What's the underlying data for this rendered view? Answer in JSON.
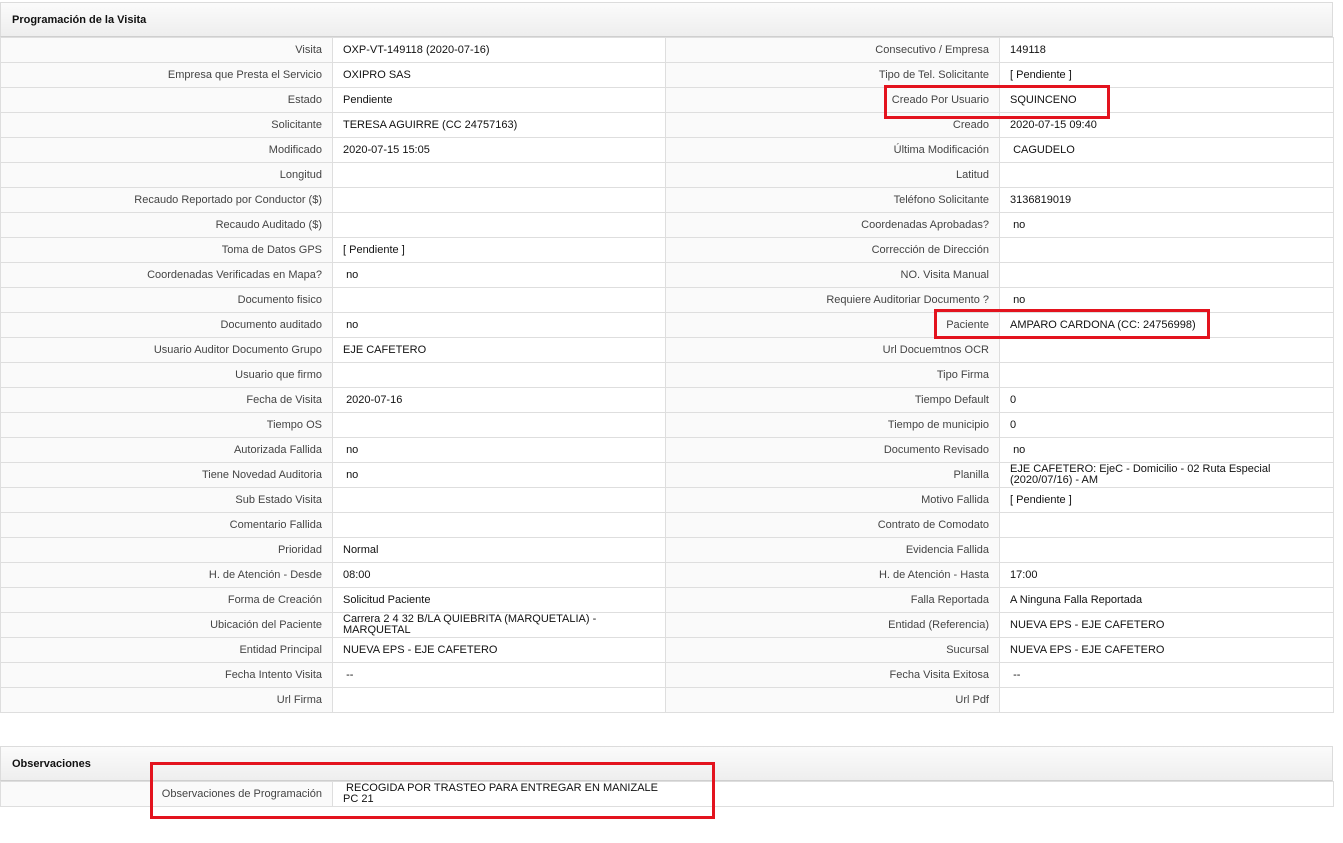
{
  "programacion": {
    "title": "Programación de la Visita",
    "rows": [
      [
        "Visita",
        "OXP-VT-149118 (2020-07-16)",
        "Consecutivo / Empresa",
        "149118"
      ],
      [
        "Empresa que Presta el Servicio",
        "OXIPRO SAS",
        "Tipo de Tel. Solicitante",
        "[ Pendiente ]"
      ],
      [
        "Estado",
        "Pendiente",
        "Creado Por Usuario",
        "SQUINCENO"
      ],
      [
        "Solicitante",
        "TERESA AGUIRRE (CC 24757163)",
        "Creado",
        "2020-07-15 09:40"
      ],
      [
        "Modificado",
        "2020-07-15 15:05",
        "Última Modificación",
        " CAGUDELO"
      ],
      [
        "Longitud",
        "",
        "Latitud",
        ""
      ],
      [
        "Recaudo Reportado por Conductor ($)",
        "",
        "Teléfono Solicitante",
        "3136819019"
      ],
      [
        "Recaudo Auditado ($)",
        "",
        "Coordenadas Aprobadas?",
        " no"
      ],
      [
        "Toma de Datos GPS",
        "[ Pendiente ]",
        "Corrección de Dirección",
        ""
      ],
      [
        "Coordenadas Verificadas en Mapa?",
        " no",
        "NO. Visita Manual",
        ""
      ],
      [
        "Documento fisico",
        "",
        "Requiere Auditoriar Documento ?",
        " no"
      ],
      [
        "Documento auditado",
        " no",
        "Paciente",
        "AMPARO CARDONA (CC: 24756998)"
      ],
      [
        "Usuario Auditor Documento Grupo",
        "EJE CAFETERO",
        "Url Docuemtnos OCR",
        ""
      ],
      [
        "Usuario que firmo",
        "",
        "Tipo Firma",
        ""
      ],
      [
        "Fecha de Visita",
        " 2020-07-16",
        "Tiempo Default",
        "0"
      ],
      [
        "Tiempo OS",
        "",
        "Tiempo de municipio",
        "0"
      ],
      [
        "Autorizada Fallida",
        " no",
        "Documento Revisado",
        " no"
      ],
      [
        "Tiene Novedad Auditoria",
        " no",
        "Planilla",
        "EJE CAFETERO: EjeC - Domicilio - 02 Ruta Especial (2020/07/16) - AM"
      ],
      [
        "Sub Estado Visita",
        "",
        "Motivo Fallida",
        "[ Pendiente ]"
      ],
      [
        "Comentario Fallida",
        "",
        "Contrato de Comodato",
        ""
      ],
      [
        "Prioridad",
        "Normal",
        "Evidencia Fallida",
        ""
      ],
      [
        "H. de Atención - Desde",
        "08:00",
        "H. de Atención - Hasta",
        "17:00"
      ],
      [
        "Forma de Creación",
        "Solicitud Paciente",
        "Falla Reportada",
        "A Ninguna Falla Reportada"
      ],
      [
        "Ubicación del Paciente",
        "Carrera 2 4 32 B/LA QUIEBRITA (MARQUETALIA) - MARQUETAL",
        "Entidad (Referencia)",
        "NUEVA EPS - EJE CAFETERO"
      ],
      [
        "Entidad Principal",
        "NUEVA EPS - EJE CAFETERO",
        "Sucursal",
        "NUEVA EPS - EJE CAFETERO"
      ],
      [
        "Fecha Intento Visita",
        " --",
        "Fecha Visita Exitosa",
        " --"
      ],
      [
        "Url Firma",
        "",
        "Url Pdf",
        ""
      ]
    ]
  },
  "observaciones": {
    "title": "Observaciones",
    "label": "Observaciones de Programación",
    "value_line1": " RECOGIDA POR TRASTEO PARA ENTREGAR EN MANIZALE",
    "value_line2": "PC 21"
  },
  "colors": {
    "highlight": "#e3131e"
  }
}
